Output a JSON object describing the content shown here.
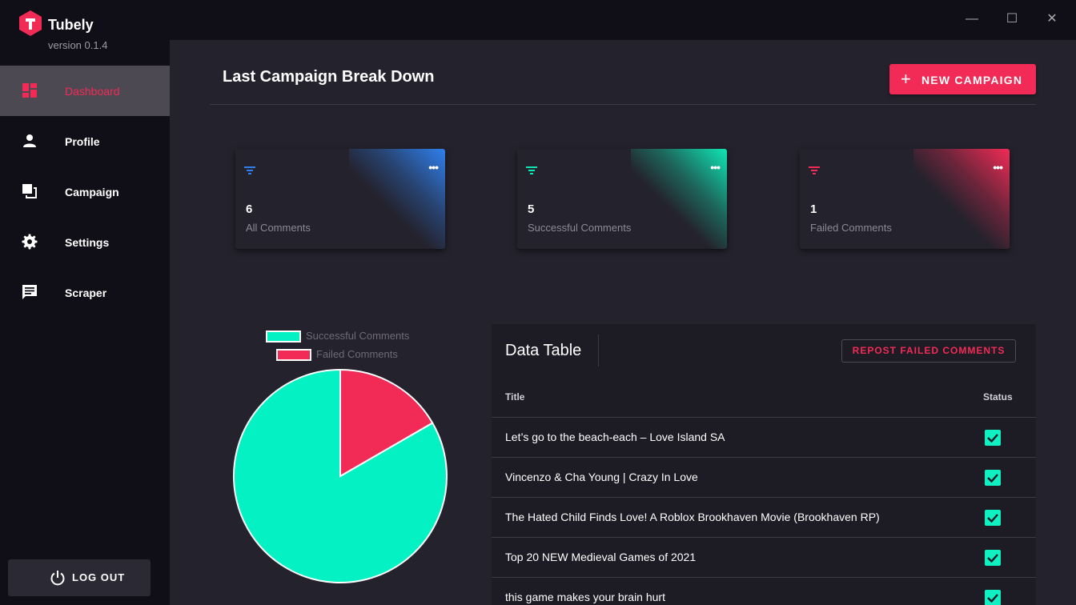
{
  "app": {
    "name": "Tubely",
    "version": "version 0.1.4"
  },
  "window": {
    "minimize": "—",
    "maximize": "☐",
    "close": "✕"
  },
  "sidebar": {
    "items": [
      {
        "label": "Dashboard",
        "icon": "dashboard-icon",
        "active": true
      },
      {
        "label": "Profile",
        "icon": "person-icon",
        "active": false
      },
      {
        "label": "Campaign",
        "icon": "copy-icon",
        "active": false
      },
      {
        "label": "Settings",
        "icon": "gear-icon",
        "active": false
      },
      {
        "label": "Scraper",
        "icon": "chat-icon",
        "active": false
      }
    ],
    "logout": "LOG OUT"
  },
  "header": {
    "title": "Last Campaign Break Down",
    "new_campaign": "NEW CAMPAIGN",
    "new_campaign_icon": "+"
  },
  "cards": [
    {
      "value": "6",
      "label": "All Comments",
      "color": "#2f80ed",
      "menu": "•••"
    },
    {
      "value": "5",
      "label": "Successful Comments",
      "color": "#0fe6b5",
      "menu": "•••"
    },
    {
      "value": "1",
      "label": "Failed Comments",
      "color": "#f22b56",
      "menu": "•••"
    }
  ],
  "chart_data": {
    "type": "pie",
    "categories": [
      "Successful Comments",
      "Failed Comments"
    ],
    "values": [
      5,
      1
    ],
    "colors": [
      "#04f1c4",
      "#f22b56"
    ],
    "legend": "top"
  },
  "table": {
    "title": "Data Table",
    "repost": "REPOST FAILED COMMENTS",
    "columns": [
      "Title",
      "Status"
    ],
    "rows": [
      {
        "title": "Let’s go to the beach-each – Love Island SA",
        "status": true
      },
      {
        "title": "Vincenzo & Cha Young | Crazy In Love",
        "status": true
      },
      {
        "title": "The Hated Child Finds Love! A Roblox Brookhaven Movie (Brookhaven RP)",
        "status": true
      },
      {
        "title": "Top 20 NEW Medieval Games of 2021",
        "status": true
      },
      {
        "title": "this game makes your brain hurt",
        "status": true
      }
    ]
  }
}
